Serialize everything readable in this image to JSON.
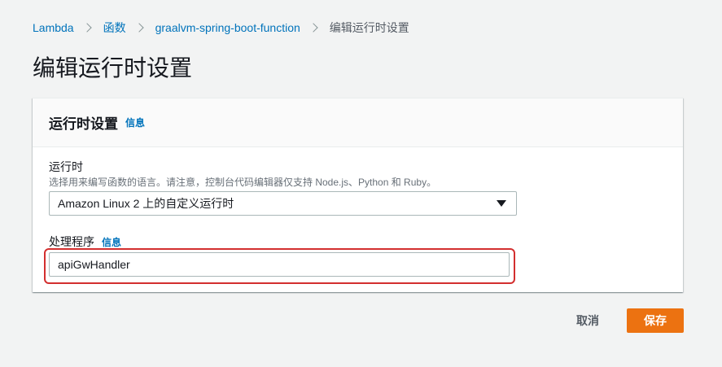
{
  "breadcrumb": {
    "items": [
      {
        "label": "Lambda"
      },
      {
        "label": "函数"
      },
      {
        "label": "graalvm-spring-boot-function"
      }
    ],
    "current": "编辑运行时设置"
  },
  "page": {
    "title": "编辑运行时设置"
  },
  "panel": {
    "title": "运行时设置",
    "info_label": "信息",
    "runtime": {
      "label": "运行时",
      "description": "选择用来编写函数的语言。请注意，控制台代码编辑器仅支持 Node.js、Python 和 Ruby。",
      "selected": "Amazon Linux 2 上的自定义运行时"
    },
    "handler": {
      "label": "处理程序",
      "info_label": "信息",
      "value": "apiGwHandler"
    }
  },
  "actions": {
    "cancel_label": "取消",
    "save_label": "保存"
  },
  "colors": {
    "link": "#0073bb",
    "primary_button": "#ec7211",
    "highlight": "#d32f2f",
    "background": "#f2f3f3"
  }
}
